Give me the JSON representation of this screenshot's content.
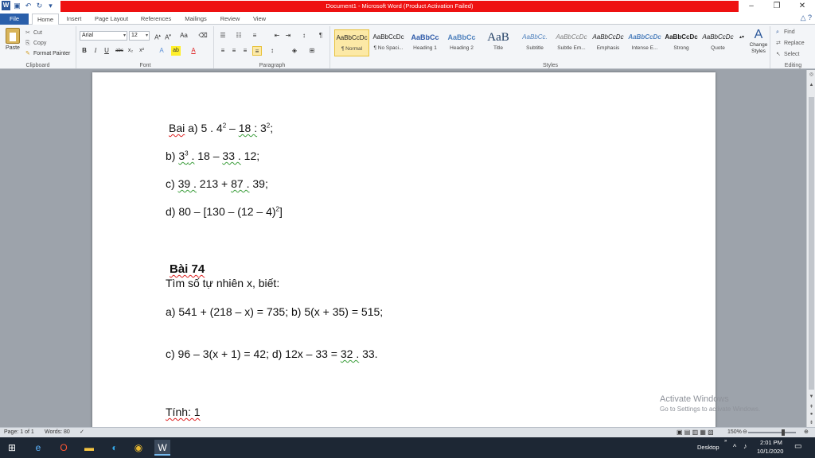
{
  "window": {
    "title": "Document1 - Microsoft Word (Product Activation Failed)",
    "controls": [
      "–",
      "❐",
      "✕"
    ]
  },
  "ribbon_tabs": [
    "File",
    "Home",
    "Insert",
    "Page Layout",
    "References",
    "Mailings",
    "Review",
    "View"
  ],
  "clipboard": {
    "paste": "Paste",
    "cut": "Cut",
    "copy": "Copy",
    "format_painter": "Format Painter",
    "label": "Clipboard"
  },
  "font": {
    "name": "Arial",
    "size": "12",
    "label": "Font"
  },
  "paragraph": {
    "label": "Paragraph"
  },
  "styles": {
    "label": "Styles",
    "items": [
      {
        "preview": "AaBbCcDc",
        "name": "¶ Normal"
      },
      {
        "preview": "AaBbCcDc",
        "name": "¶ No Spaci..."
      },
      {
        "preview": "AaBbCc",
        "name": "Heading 1"
      },
      {
        "preview": "AaBbCc",
        "name": "Heading 2"
      },
      {
        "preview": "AaB",
        "name": "Title"
      },
      {
        "preview": "AaBbCc.",
        "name": "Subtitle"
      },
      {
        "preview": "AaBbCcDc",
        "name": "Subtle Em..."
      },
      {
        "preview": "AaBbCcDc",
        "name": "Emphasis"
      },
      {
        "preview": "AaBbCcDc",
        "name": "Intense E..."
      },
      {
        "preview": "AaBbCcDc",
        "name": "Strong"
      },
      {
        "preview": "AaBbCcDc",
        "name": "Quote"
      }
    ],
    "change_styles": "Change Styles"
  },
  "editing": {
    "find": "Find",
    "replace": "Replace",
    "select": "Select",
    "label": "Editing"
  },
  "document": {
    "line1": {
      "prefix": "Bai",
      "text": " a) 5 . 4",
      "exp": "2",
      "rest": " – ",
      "hl": "18 :",
      "tail": " 3",
      "exp2": "2",
      "end": ";"
    },
    "line2": {
      "pre": "b) ",
      "hl": "3",
      "exp": "3",
      "hl2": " .",
      "mid": " 18 – ",
      "hl3": "33 .",
      "end": " 12;"
    },
    "line3": {
      "pre": "c) ",
      "hl": "39 .",
      "mid": " 213 + ",
      "hl2": "87 .",
      "end": " 39;"
    },
    "line4": {
      "pre": "d) 80 – [130 – (12 – 4)",
      "exp": "2",
      "end": "]"
    },
    "heading": "Bài 74",
    "task": "Tìm số tự nhiên x, biết:",
    "eq1": "a) 541 + (218 – x) = 735; b) 5(x + 35) = 515;",
    "eq2_pre": "c) 96 – 3(x + 1) = 42; d) 12x – 33 = ",
    "eq2_hl": "32 .",
    "eq2_end": " 33.",
    "tinh": "Tính: 1"
  },
  "watermark": {
    "line1": "Activate Windows",
    "line2": "Go to Settings to activate Windows."
  },
  "status": {
    "page": "Page: 1 of 1",
    "words": "Words: 80",
    "zoom": "150%"
  },
  "taskbar": {
    "desktop": "Desktop",
    "time": "2:01 PM",
    "date": "10/1/2020"
  }
}
